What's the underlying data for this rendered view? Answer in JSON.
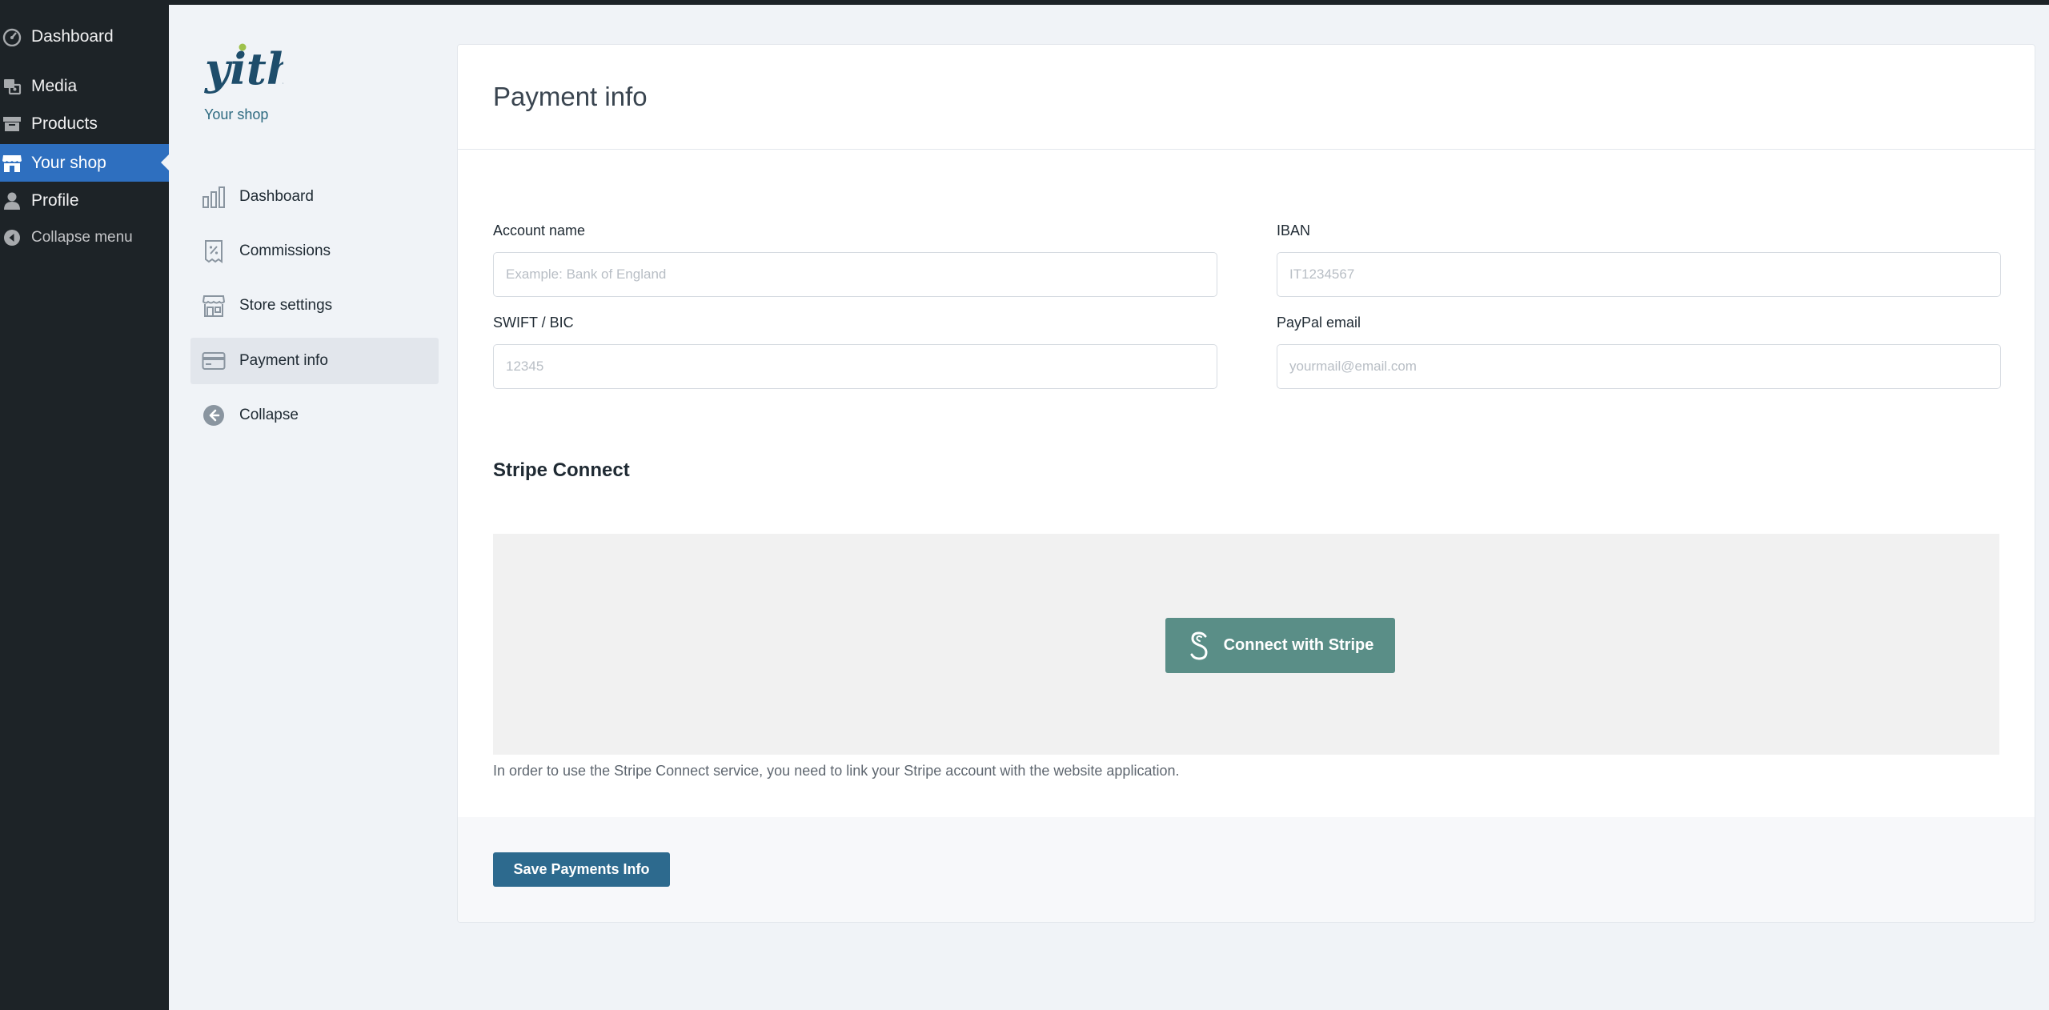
{
  "wp_sidebar": {
    "items": [
      {
        "label": "Dashboard",
        "icon": "dashboard-icon"
      },
      {
        "label": "Media",
        "icon": "media-icon"
      },
      {
        "label": "Products",
        "icon": "archive-icon"
      },
      {
        "label": "Your shop",
        "icon": "store-icon"
      },
      {
        "label": "Profile",
        "icon": "user-icon"
      },
      {
        "label": "Collapse menu",
        "icon": "collapse-icon"
      }
    ]
  },
  "plugin": {
    "logo_text": "yith",
    "shop_name": "Your shop",
    "nav": [
      {
        "label": "Dashboard",
        "icon": "bar-chart-icon"
      },
      {
        "label": "Commissions",
        "icon": "receipt-percent-icon"
      },
      {
        "label": "Store settings",
        "icon": "store-icon"
      },
      {
        "label": "Payment info",
        "icon": "credit-card-icon"
      },
      {
        "label": "Collapse",
        "icon": "arrow-left-circle-icon"
      }
    ]
  },
  "page": {
    "title": "Payment info",
    "fields": {
      "account_name": {
        "label": "Account name",
        "placeholder": "Example: Bank of England",
        "value": ""
      },
      "iban": {
        "label": "IBAN",
        "placeholder": "IT1234567",
        "value": ""
      },
      "swift": {
        "label": "SWIFT / BIC",
        "placeholder": "12345",
        "value": ""
      },
      "paypal": {
        "label": "PayPal email",
        "placeholder": "yourmail@email.com",
        "value": ""
      }
    },
    "stripe": {
      "section_title": "Stripe Connect",
      "button_label": "Connect with Stripe",
      "description": "In order to use the Stripe Connect service, you need to link your Stripe account with the website application."
    },
    "save_label": "Save Payments Info"
  },
  "colors": {
    "wp_sidebar_bg": "#1d2327",
    "wp_active": "#2e6fbf",
    "stripe_button": "#5a8e87",
    "save_button": "#2d6a8e",
    "page_bg": "#f0f3f7"
  }
}
